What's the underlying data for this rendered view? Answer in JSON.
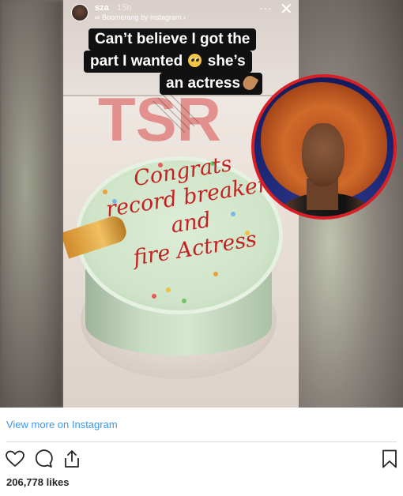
{
  "story": {
    "username": "sza",
    "time": "15h",
    "subtitle": "∞ Boomerang by instagram ›",
    "more_label": "···",
    "close_label": "✕",
    "caption_lines": [
      "Can’t believe I got the",
      "part I wanted",
      "she’s",
      "an actress"
    ],
    "cake_text": [
      "Congrats",
      "record breaker",
      "and",
      "fire Actress"
    ],
    "watermark": "TSR"
  },
  "link": {
    "view_more": "View more on Instagram"
  },
  "actions": {
    "like_icon": "heart-outline-icon",
    "comment_icon": "speech-bubble-icon",
    "share_icon": "share-upload-icon",
    "save_icon": "bookmark-outline-icon"
  },
  "likes": {
    "text": "206,778 likes"
  },
  "colors": {
    "link": "#3897f0",
    "inset_border": "#d91f26",
    "cake_text": "#c42222"
  }
}
